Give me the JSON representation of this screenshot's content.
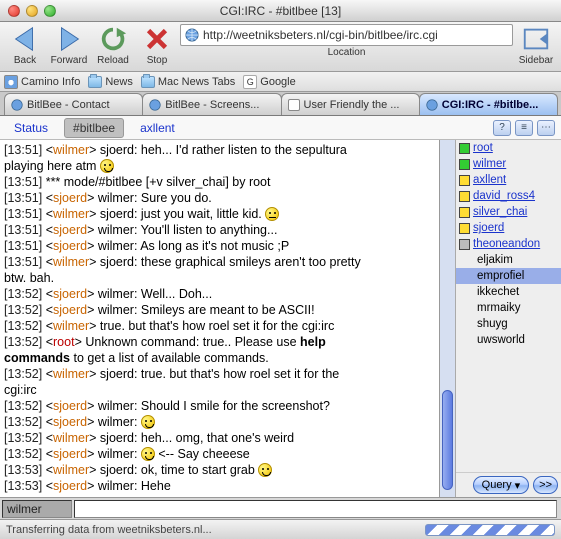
{
  "window": {
    "title": "CGI:IRC - #bitlbee [13]"
  },
  "toolbar": {
    "back": "Back",
    "forward": "Forward",
    "reload": "Reload",
    "stop": "Stop",
    "location_label": "Location",
    "sidebar": "Sidebar",
    "url": "http://weetniksbeters.nl/cgi-bin/bitlbee/irc.cgi"
  },
  "bookmarks": [
    {
      "label": "Camino Info"
    },
    {
      "label": "News"
    },
    {
      "label": "Mac News Tabs"
    },
    {
      "label": "Google"
    }
  ],
  "tabs": [
    {
      "label": "BitlBee - Contact"
    },
    {
      "label": "BitlBee - Screens..."
    },
    {
      "label": "User Friendly the ..."
    },
    {
      "label": "CGI:IRC - #bitlbe..."
    }
  ],
  "status_tabs": {
    "status": "Status",
    "channel": "#bitlbee",
    "extra": "axllent",
    "help": "?",
    "menu1": "≡",
    "menu2": "⋯"
  },
  "chat": [
    {
      "ts": "[13:51]",
      "nick": "wilmer",
      "cls": "nk-wilmer",
      "text": " sjoerd: heh... I'd rather listen to the sepultura"
    },
    {
      "raw": "playing here atm ",
      "smiley": "smile"
    },
    {
      "ts": "[13:51]",
      "sys": "*** mode/#bitlbee [+v silver_chai] by root"
    },
    {
      "ts": "[13:51]",
      "nick": "sjoerd",
      "cls": "nk-sjoerd",
      "text": " wilmer: Sure you do."
    },
    {
      "ts": "[13:51]",
      "nick": "wilmer",
      "cls": "nk-wilmer",
      "text": " sjoerd: just you wait, little kid. ",
      "smiley": "uneasy"
    },
    {
      "ts": "[13:51]",
      "nick": "sjoerd",
      "cls": "nk-sjoerd",
      "text": " wilmer: You'll listen to anything..."
    },
    {
      "ts": "[13:51]",
      "nick": "sjoerd",
      "cls": "nk-sjoerd",
      "text": " wilmer: As long as it's not music ;P"
    },
    {
      "ts": "[13:51]",
      "nick": "wilmer",
      "cls": "nk-wilmer",
      "text": " sjoerd: these graphical smileys aren't too pretty"
    },
    {
      "raw": "btw. bah."
    },
    {
      "ts": "[13:52]",
      "nick": "sjoerd",
      "cls": "nk-sjoerd",
      "text": " wilmer: Well... Doh..."
    },
    {
      "ts": "[13:52]",
      "nick": "sjoerd",
      "cls": "nk-sjoerd",
      "text": " wilmer: Smileys are meant to be ASCII!"
    },
    {
      "ts": "[13:52]",
      "nick": "wilmer",
      "cls": "nk-wilmer",
      "text": " true. but that's how roel set it for the cgi:irc"
    },
    {
      "ts": "[13:52]",
      "nick": "root",
      "cls": "nk-root",
      "text": " Unknown command: true.. Please use ",
      "bold": "help"
    },
    {
      "raw2": "commands",
      "text": " to get a list of available commands."
    },
    {
      "ts": "[13:52]",
      "nick": "wilmer",
      "cls": "nk-wilmer",
      "text": " sjoerd: true. but that's how roel set it for the"
    },
    {
      "raw": "cgi:irc"
    },
    {
      "ts": "[13:52]",
      "nick": "sjoerd",
      "cls": "nk-sjoerd",
      "text": " wilmer: Should I smile for the screenshot?"
    },
    {
      "ts": "[13:52]",
      "nick": "sjoerd",
      "cls": "nk-sjoerd",
      "text": " wilmer: ",
      "smiley": "smile"
    },
    {
      "ts": "[13:52]",
      "nick": "wilmer",
      "cls": "nk-wilmer",
      "text": " sjoerd: heh... omg, that one's weird"
    },
    {
      "ts": "[13:52]",
      "nick": "sjoerd",
      "cls": "nk-sjoerd",
      "text": " wilmer: ",
      "smiley": "smile",
      "tail": " <-- Say cheeese"
    },
    {
      "ts": "[13:53]",
      "nick": "wilmer",
      "cls": "nk-wilmer",
      "text": " sjoerd: ok, time to start  grab ",
      "smiley": "smile"
    },
    {
      "ts": "[13:53]",
      "nick": "sjoerd",
      "cls": "nk-sjoerd",
      "text": " wilmer: Hehe"
    }
  ],
  "nicks_online": [
    {
      "name": "root",
      "box": "g"
    },
    {
      "name": "wilmer",
      "box": "g"
    },
    {
      "name": "axllent",
      "box": "y"
    },
    {
      "name": "david_ross4",
      "box": "y"
    },
    {
      "name": "silver_chai",
      "box": "y"
    },
    {
      "name": "sjoerd",
      "box": "y"
    },
    {
      "name": "theoneandon",
      "box": "gray"
    }
  ],
  "nicks_other": [
    "eljakim",
    "emprofiel",
    "ikkechet",
    "mrmaiky",
    "shuyg",
    "uwsworld"
  ],
  "nick_selected": "emprofiel",
  "nickfoot": {
    "query": "Query",
    "go": ">>"
  },
  "input": {
    "nick": "wilmer"
  },
  "statusbar": {
    "text": "Transferring data from weetniksbeters.nl..."
  }
}
